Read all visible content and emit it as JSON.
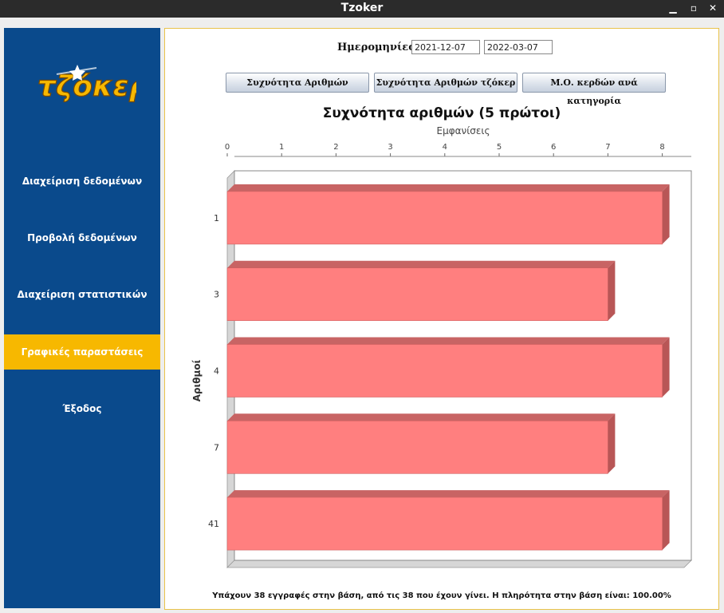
{
  "window": {
    "title": "Tzoker"
  },
  "sidebar": {
    "logo_text": "τζόκερ",
    "items": [
      {
        "label": "Διαχείριση δεδομένων",
        "active": false
      },
      {
        "label": "Προβολή δεδομένων",
        "active": false
      },
      {
        "label": "Διαχείριση στατιστικών",
        "active": false
      },
      {
        "label": "Γραφικές παραστάσεις",
        "active": true
      },
      {
        "label": "Έξοδος",
        "active": false
      }
    ]
  },
  "filters": {
    "dates_label": "Ημερομηνίες",
    "date_from": "2021-12-07",
    "date_to": "2022-03-07"
  },
  "buttons": {
    "freq_numbers": "Συχνότητα Αριθμών",
    "freq_joker": "Συχνότητα Αριθμών τζόκερ",
    "avg_winnings": "Μ.Ο. κερδών ανά κατηγορία"
  },
  "chart_data": {
    "type": "bar",
    "orientation": "horizontal",
    "title": "Συχνότητα αριθμών (5 πρώτοι)",
    "xlabel": "Εμφανίσεις",
    "ylabel": "Αριθμοί",
    "categories": [
      "1",
      "3",
      "4",
      "7",
      "41"
    ],
    "values": [
      8,
      7,
      8,
      7,
      8
    ],
    "ticks": [
      "0",
      "1",
      "2",
      "3",
      "4",
      "5",
      "6",
      "7",
      "8"
    ],
    "xlim": [
      0,
      8.4
    ],
    "bar_color": "#ff7f7f",
    "style": "3d",
    "axis_position": "top",
    "grid": false,
    "legend": "none"
  },
  "footer": {
    "status": "Υπάχουν 38 εγγραφές στην βάση, από τις 38 που έχουν γίνει. Η πληρότητα στην βάση είναι: 100.00%"
  },
  "colors": {
    "sidebar_bg": "#0a4a8c",
    "active_item": "#f7b800",
    "logo_fill": "#f7b800",
    "bar": "#ff7f7f"
  }
}
